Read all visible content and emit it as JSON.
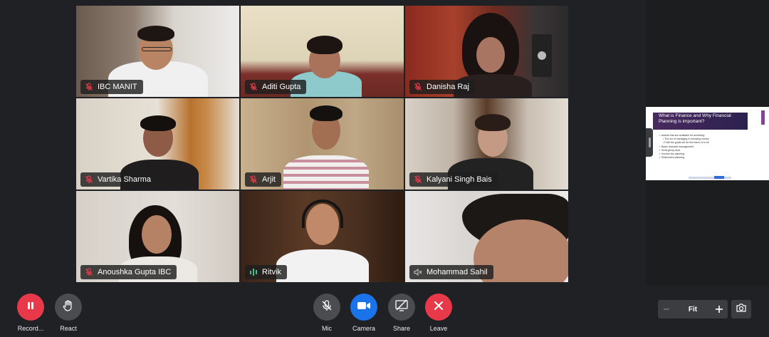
{
  "participants": [
    {
      "name": "IBC MANIT",
      "status": "muted"
    },
    {
      "name": "Aditi Gupta",
      "status": "muted"
    },
    {
      "name": "Danisha Raj",
      "status": "muted"
    },
    {
      "name": "Vartika Sharma",
      "status": "muted"
    },
    {
      "name": "Arjit",
      "status": "muted"
    },
    {
      "name": "Kalyani Singh Bais",
      "status": "muted"
    },
    {
      "name": "Anoushka Gupta IBC",
      "status": "muted"
    },
    {
      "name": "Ritvik",
      "status": "speaking"
    },
    {
      "name": "Mohammad Sahil",
      "status": "speaker-muted"
    }
  ],
  "slide": {
    "title": "What is Finance and Why Financial Planning is important?",
    "bullets": [
      {
        "text": "Assets that are available for achieving",
        "sub": false
      },
      {
        "text": "The art of managing & investing money",
        "sub": true
      },
      {
        "text": "Fulfil the goals set for the future & to be",
        "sub": true
      },
      {
        "text": "Basic financial management",
        "sub": false
      },
      {
        "text": "Emergency fund",
        "sub": false
      },
      {
        "text": "Income tax planning",
        "sub": false
      },
      {
        "text": "Retirement planning",
        "sub": false
      }
    ]
  },
  "controls": {
    "record": {
      "label": "Record...",
      "icon": "pause-icon"
    },
    "react": {
      "label": "React",
      "icon": "hand-icon"
    },
    "mic": {
      "label": "Mic",
      "icon": "mic-off-icon"
    },
    "camera": {
      "label": "Camera",
      "icon": "video-camera-icon"
    },
    "share": {
      "label": "Share",
      "icon": "screen-share-icon"
    },
    "leave": {
      "label": "Leave",
      "icon": "close-icon"
    }
  },
  "zoom": {
    "value": "Fit"
  },
  "colors": {
    "record": "#e8394a",
    "leave": "#e8394a",
    "camera": "#1a73e8",
    "muted_icon": "#e8394a",
    "speaking_icon": "#3ec28f"
  }
}
